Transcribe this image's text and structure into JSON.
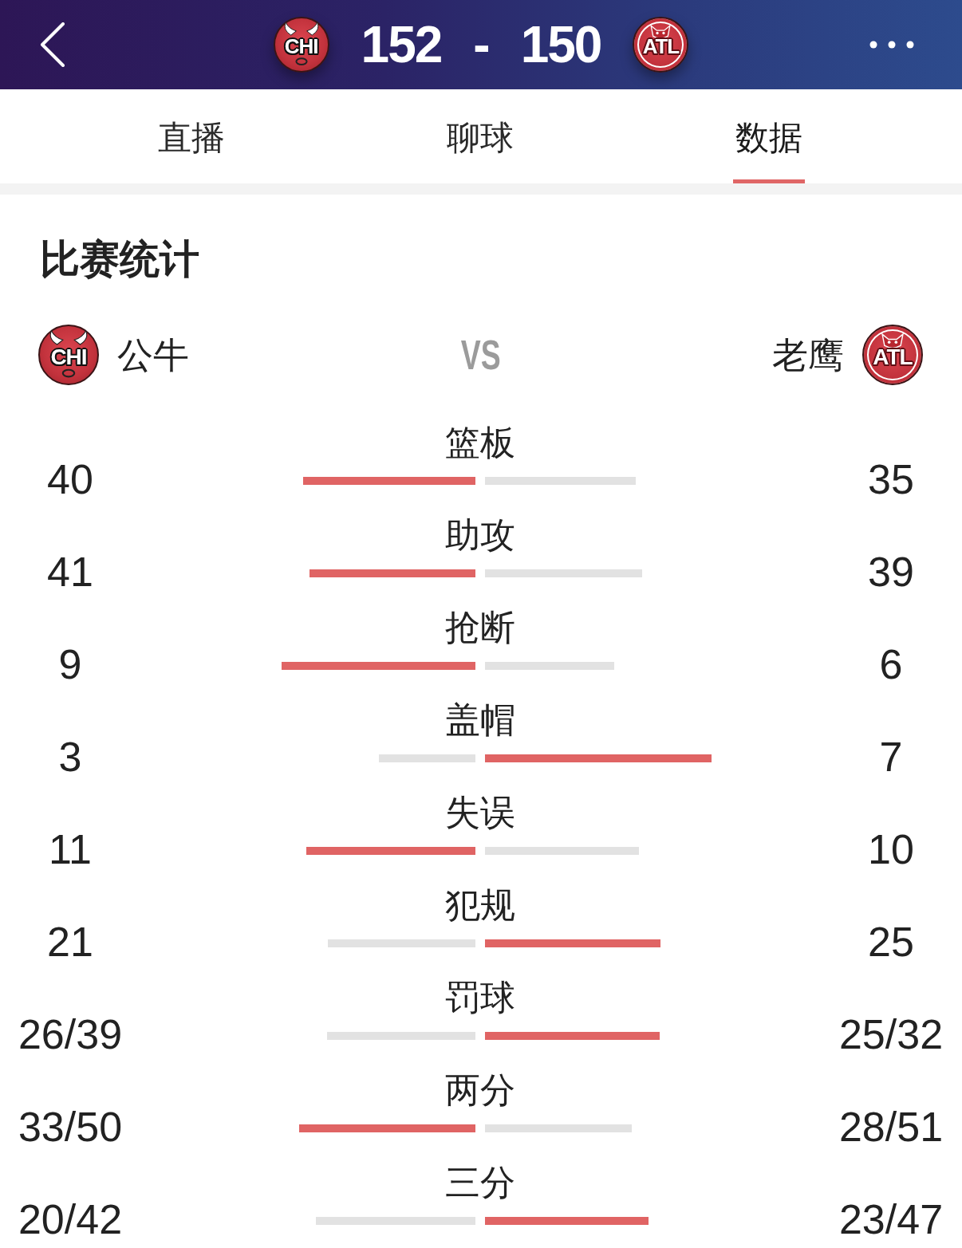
{
  "header": {
    "home": {
      "logo_text": "CHI",
      "score": "152"
    },
    "separator": "-",
    "away": {
      "logo_text": "ATL",
      "score": "150"
    }
  },
  "tabs": [
    {
      "label": "直播",
      "selected": false
    },
    {
      "label": "聊球",
      "selected": false
    },
    {
      "label": "数据",
      "selected": true
    }
  ],
  "match_stats": {
    "title": "比赛统计",
    "home": {
      "logo_text": "CHI",
      "name": "公牛"
    },
    "vs": "VS",
    "away": {
      "logo_text": "ATL",
      "name": "老鹰"
    },
    "rows": [
      {
        "label": "篮板",
        "home": {
          "value": "40",
          "level": 0.533,
          "highlighted": true
        },
        "away": {
          "value": "35",
          "level": 0.467,
          "highlighted": false
        }
      },
      {
        "label": "助攻",
        "home": {
          "value": "41",
          "level": 0.513,
          "highlighted": true
        },
        "away": {
          "value": "39",
          "level": 0.487,
          "highlighted": false
        }
      },
      {
        "label": "抢断",
        "home": {
          "value": "9",
          "level": 0.6,
          "highlighted": true
        },
        "away": {
          "value": "6",
          "level": 0.4,
          "highlighted": false
        }
      },
      {
        "label": "盖帽",
        "home": {
          "value": "3",
          "level": 0.3,
          "highlighted": false
        },
        "away": {
          "value": "7",
          "level": 0.7,
          "highlighted": true
        }
      },
      {
        "label": "失误",
        "home": {
          "value": "11",
          "level": 0.524,
          "highlighted": true
        },
        "away": {
          "value": "10",
          "level": 0.476,
          "highlighted": false
        }
      },
      {
        "label": "犯规",
        "home": {
          "value": "21",
          "level": 0.457,
          "highlighted": false
        },
        "away": {
          "value": "25",
          "level": 0.543,
          "highlighted": true
        }
      },
      {
        "label": "罚球",
        "home": {
          "value": "26/39",
          "level": 0.46,
          "highlighted": false
        },
        "away": {
          "value": "25/32",
          "level": 0.54,
          "highlighted": true
        }
      },
      {
        "label": "两分",
        "home": {
          "value": "33/50",
          "level": 0.546,
          "highlighted": true
        },
        "away": {
          "value": "28/51",
          "level": 0.454,
          "highlighted": false
        }
      },
      {
        "label": "三分",
        "home": {
          "value": "20/42",
          "level": 0.493,
          "highlighted": false
        },
        "away": {
          "value": "23/47",
          "level": 0.507,
          "highlighted": true
        }
      }
    ]
  }
}
